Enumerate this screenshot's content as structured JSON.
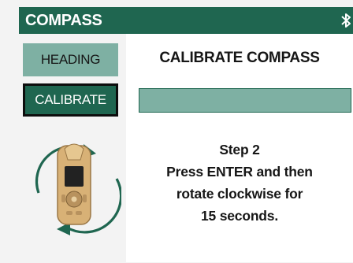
{
  "header": {
    "title": "COMPASS",
    "status_icon": "bluetooth-icon"
  },
  "sidebar": {
    "heading_label": "HEADING",
    "calibrate_label": "CALIBRATE",
    "selected": "CALIBRATE",
    "illustration_icon": "rotate-device-icon"
  },
  "main": {
    "title": "CALIBRATE COMPASS",
    "instructions": {
      "line1": "Step 2",
      "line2": "Press ENTER and then",
      "line3": "rotate clockwise for",
      "line4": "15 seconds."
    }
  },
  "colors": {
    "accent_dark": "#1f6650",
    "accent_light": "#7eb0a3",
    "background": "#f3f3f3",
    "panel": "#ffffff"
  }
}
